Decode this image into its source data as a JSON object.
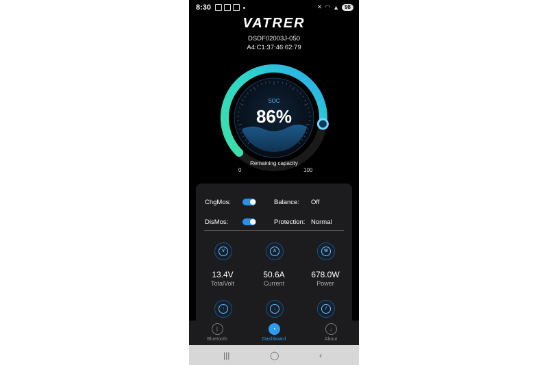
{
  "status_bar": {
    "time": "8:30",
    "battery": "98"
  },
  "header": {
    "logo": "VATRER",
    "device_name": "DSDF02003J-050",
    "device_mac": "A4:C1:37:46:62:79"
  },
  "gauge": {
    "label": "SOC",
    "value_text": "86%",
    "percent": 86,
    "caption": "Remaining capacity",
    "scale_min": "0",
    "scale_max": "100",
    "accent_color": "#2fc8e8"
  },
  "status": {
    "chg_mos_label": "ChgMos:",
    "chg_mos_on": true,
    "dis_mos_label": "DisMos:",
    "dis_mos_on": true,
    "balance_label": "Balance:",
    "balance_value": "Off",
    "protection_label": "Protection:",
    "protection_value": "Normal"
  },
  "metrics": [
    {
      "icon": "volt-icon",
      "glyph": "V",
      "value": "13.4V",
      "label": "TotalVolt"
    },
    {
      "icon": "current-icon",
      "glyph": "A",
      "value": "50.6A",
      "label": "Current"
    },
    {
      "icon": "power-icon",
      "glyph": "W",
      "value": "678.0W",
      "label": "Power"
    }
  ],
  "metrics_row2_icons": [
    "charge-icon",
    "discharge-icon",
    "temperature-icon"
  ],
  "nav": {
    "items": [
      {
        "label": "Bluetooth",
        "icon": "bluetooth-icon"
      },
      {
        "label": "Dashboard",
        "icon": "dashboard-icon"
      },
      {
        "label": "About",
        "icon": "about-icon"
      }
    ],
    "active_index": 1
  },
  "colors": {
    "primary": "#2d9bf0",
    "background": "#000000",
    "panel": "#1c1c1e"
  }
}
